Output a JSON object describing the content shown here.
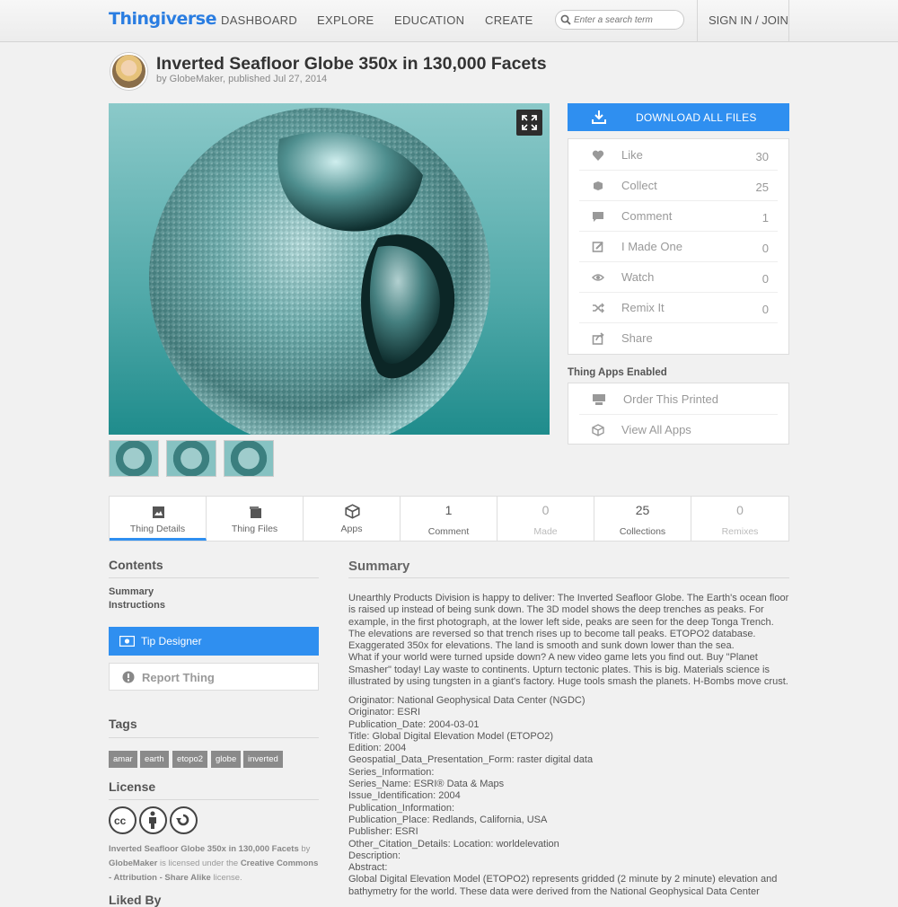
{
  "header": {
    "logo": "Thingiverse",
    "nav": [
      "DASHBOARD",
      "EXPLORE",
      "EDUCATION",
      "CREATE"
    ],
    "search_placeholder": "Enter a search term",
    "signin": "SIGN IN / JOIN"
  },
  "thing": {
    "title": "Inverted Seafloor Globe 350x in 130,000 Facets",
    "byline": "by GlobeMaker, published Jul 27, 2014"
  },
  "sidebar": {
    "download": "DOWNLOAD ALL FILES",
    "actions": [
      {
        "label": "Like",
        "count": "30",
        "icon": "heart-icon"
      },
      {
        "label": "Collect",
        "count": "25",
        "icon": "collect-icon"
      },
      {
        "label": "Comment",
        "count": "1",
        "icon": "comment-icon"
      },
      {
        "label": "I Made One",
        "count": "0",
        "icon": "made-icon"
      },
      {
        "label": "Watch",
        "count": "0",
        "icon": "eye-icon"
      },
      {
        "label": "Remix It",
        "count": "0",
        "icon": "remix-icon"
      },
      {
        "label": "Share",
        "count": "",
        "icon": "share-icon"
      }
    ],
    "apps_title": "Thing Apps Enabled",
    "apps": [
      {
        "label": "Order This Printed",
        "icon": "printer-icon"
      },
      {
        "label": "View All Apps",
        "icon": "cube-icon"
      }
    ]
  },
  "tabs": [
    {
      "label": "Thing Details",
      "num": "",
      "icon": "details-icon"
    },
    {
      "label": "Thing Files",
      "num": "",
      "icon": "files-icon"
    },
    {
      "label": "Apps",
      "num": "",
      "icon": "cube-icon"
    },
    {
      "label": "Comment",
      "num": "1"
    },
    {
      "label": "Made",
      "num": "0"
    },
    {
      "label": "Collections",
      "num": "25"
    },
    {
      "label": "Remixes",
      "num": "0"
    }
  ],
  "left": {
    "contents_title": "Contents",
    "contents_links": [
      "Summary",
      "Instructions"
    ],
    "tip": "Tip Designer",
    "report": "Report Thing",
    "tags_title": "Tags",
    "tags": [
      "amar",
      "earth",
      "etopo2",
      "globe",
      "inverted"
    ],
    "license_title": "License",
    "license_thing": "Inverted Seafloor Globe 350x in 130,000 Facets",
    "license_by": "by",
    "license_author": "GlobeMaker",
    "license_mid": "is licensed under the",
    "license_name": "Creative Commons - Attribution - Share Alike",
    "license_end": "license.",
    "liked_title": "Liked By"
  },
  "summary": {
    "title": "Summary",
    "paragraph": "Unearthly Products Division is happy to deliver: The Inverted Seafloor Globe. The Earth's ocean floor is raised up instead of being sunk down. The 3D model shows the deep trenches as peaks. For example, in the first photograph, at the lower left side, peaks are seen for the deep Tonga Trench. The elevations are reversed so that trench rises up to become tall peaks. ETOPO2 database. Exaggerated 350x for elevations. The land is smooth and sunk down lower than the sea.",
    "paragraph2": "What if your world were turned upside down? A new video game lets you find out. Buy \"Planet Smasher\" today! Lay waste to continents. Upturn tectonic plates. This is big. Materials science is illustrated by using tungsten in a giant's factory. Huge tools smash the planets. H-Bombs move crust.",
    "meta": [
      "Originator: National Geophysical Data Center (NGDC)",
      "Originator: ESRI",
      "Publication_Date: 2004-03-01",
      "Title: Global Digital Elevation Model (ETOPO2)",
      "Edition: 2004",
      "Geospatial_Data_Presentation_Form: raster digital data",
      "Series_Information:",
      "Series_Name: ESRI® Data & Maps",
      "Issue_Identification: 2004",
      "Publication_Information:",
      "Publication_Place: Redlands, California, USA",
      "Publisher: ESRI",
      "Other_Citation_Details: Location: worldelevation",
      "Description:",
      "Abstract:"
    ],
    "abstract": "Global Digital Elevation Model (ETOPO2) represents gridded (2 minute by 2 minute) elevation and bathymetry for the world. These data were derived from the National Geophysical Data Center"
  }
}
